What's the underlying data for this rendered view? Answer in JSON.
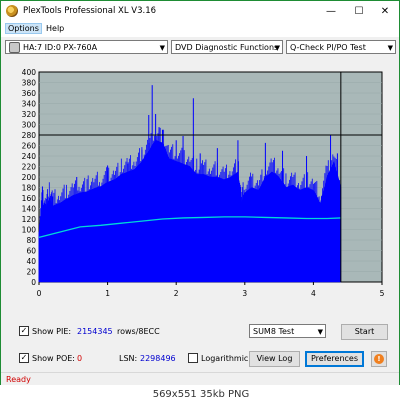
{
  "window": {
    "title": "PlexTools Professional XL V3.16"
  },
  "titlebar_buttons": {
    "minimize": "—",
    "maximize": "☐",
    "close": "✕"
  },
  "menu": {
    "items": [
      "Options",
      "Help"
    ]
  },
  "toolbar": {
    "drive": "HA:7 ID:0  PX-760A",
    "function": "DVD Diagnostic Functions",
    "test": "Q-Check PI/PO Test"
  },
  "chart_data": {
    "type": "area",
    "xlim": [
      0,
      5
    ],
    "ylim": [
      0,
      400
    ],
    "x_ticks": [
      "0",
      "1",
      "2",
      "3",
      "4",
      "5"
    ],
    "y_ticks": [
      "400",
      "380",
      "360",
      "340",
      "320",
      "300",
      "280",
      "260",
      "240",
      "220",
      "200",
      "180",
      "160",
      "140",
      "120",
      "100",
      "80",
      "60",
      "40",
      "20",
      "0"
    ],
    "reference_line_y": 280,
    "cursor_x": 4.4,
    "background_color": "#a9b8b8",
    "fill_color": "#0000ff",
    "average_line_color": "#00d8d8",
    "pi_upper_envelope": [
      [
        0,
        95
      ],
      [
        0.05,
        150
      ],
      [
        0.1,
        140
      ],
      [
        0.15,
        160
      ],
      [
        0.2,
        145
      ],
      [
        0.3,
        150
      ],
      [
        0.4,
        158
      ],
      [
        0.5,
        165
      ],
      [
        0.6,
        170
      ],
      [
        0.7,
        172
      ],
      [
        0.8,
        178
      ],
      [
        0.9,
        182
      ],
      [
        1.0,
        190
      ],
      [
        1.1,
        195
      ],
      [
        1.2,
        205
      ],
      [
        1.3,
        210
      ],
      [
        1.4,
        215
      ],
      [
        1.5,
        230
      ],
      [
        1.6,
        250
      ],
      [
        1.7,
        270
      ],
      [
        1.8,
        265
      ],
      [
        1.9,
        235
      ],
      [
        2.0,
        230
      ],
      [
        2.1,
        225
      ],
      [
        2.2,
        220
      ],
      [
        2.3,
        205
      ],
      [
        2.4,
        205
      ],
      [
        2.5,
        200
      ],
      [
        2.6,
        200
      ],
      [
        2.7,
        195
      ],
      [
        2.8,
        200
      ],
      [
        2.9,
        210
      ],
      [
        2.95,
        150
      ],
      [
        3.0,
        170
      ],
      [
        3.1,
        180
      ],
      [
        3.2,
        175
      ],
      [
        3.3,
        200
      ],
      [
        3.4,
        210
      ],
      [
        3.5,
        200
      ],
      [
        3.6,
        180
      ],
      [
        3.7,
        185
      ],
      [
        3.8,
        175
      ],
      [
        3.9,
        180
      ],
      [
        4.0,
        175
      ],
      [
        4.1,
        150
      ],
      [
        4.2,
        200
      ],
      [
        4.3,
        230
      ],
      [
        4.4,
        180
      ]
    ],
    "pi_spikes": [
      [
        0.05,
        182
      ],
      [
        0.55,
        200
      ],
      [
        1.0,
        222
      ],
      [
        1.3,
        225
      ],
      [
        1.5,
        252
      ],
      [
        1.6,
        318
      ],
      [
        1.65,
        375
      ],
      [
        1.7,
        320
      ],
      [
        1.75,
        295
      ],
      [
        1.8,
        290
      ],
      [
        2.0,
        270
      ],
      [
        2.1,
        278
      ],
      [
        2.25,
        350
      ],
      [
        2.35,
        245
      ],
      [
        2.6,
        255
      ],
      [
        2.9,
        270
      ],
      [
        3.3,
        265
      ],
      [
        3.55,
        250
      ],
      [
        3.9,
        240
      ],
      [
        4.25,
        280
      ],
      [
        4.35,
        245
      ]
    ],
    "average_line": [
      [
        0,
        85
      ],
      [
        0.3,
        95
      ],
      [
        0.6,
        105
      ],
      [
        0.9,
        108
      ],
      [
        1.2,
        112
      ],
      [
        1.5,
        116
      ],
      [
        1.8,
        120
      ],
      [
        2.1,
        122
      ],
      [
        2.4,
        123
      ],
      [
        2.7,
        124
      ],
      [
        3.0,
        124
      ],
      [
        3.3,
        123
      ],
      [
        3.6,
        122
      ],
      [
        3.9,
        121
      ],
      [
        4.2,
        121
      ],
      [
        4.4,
        122
      ]
    ]
  },
  "controls": {
    "show_pie_label": "Show PIE:",
    "show_pie_value": "2154345",
    "rows_label": "rows/8ECC",
    "show_poe_label": "Show POE:",
    "show_poe_value": "0",
    "lsn_label": "LSN:",
    "lsn_value": "2298496",
    "logarithmic_label": "Logarithmic",
    "test_select": "SUM8 Test",
    "start_label": "Start",
    "view_log_label": "View Log",
    "preferences_label": "Preferences",
    "help_icon": "!"
  },
  "status": {
    "text": "Ready"
  },
  "caption": {
    "text": "569x551  35kb  PNG"
  }
}
